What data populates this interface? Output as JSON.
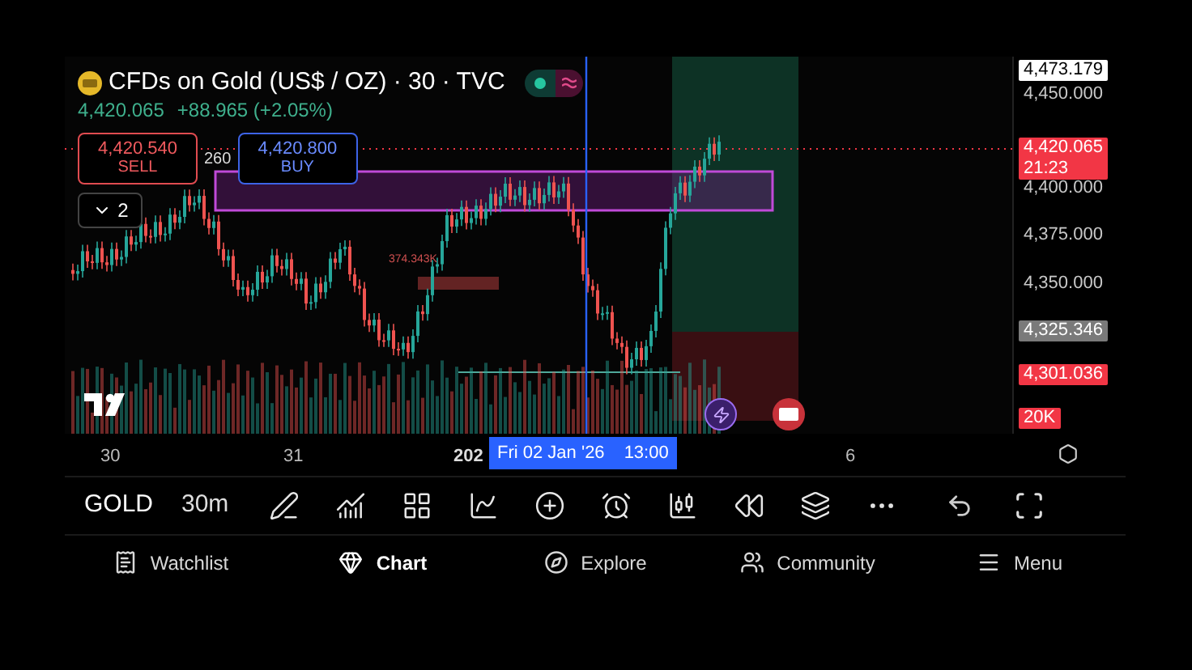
{
  "header": {
    "title": "CFDs on Gold (US$ / OZ) · 30 · TVC",
    "market_open": true,
    "price": "4,420.065",
    "change": "+88.965 (+2.05%)"
  },
  "trade": {
    "sell_price": "4,420.540",
    "sell_label": "SELL",
    "spread": "260",
    "buy_price": "4,420.800",
    "buy_label": "BUY"
  },
  "indicators_toggle": {
    "count": "2",
    "expanded": false
  },
  "chart_annotations": [
    "374.343K"
  ],
  "price_scale": [
    {
      "text": "4,473.179",
      "kind": "highlight"
    },
    {
      "text": "4,450.000",
      "kind": "tick"
    },
    {
      "text": "4,420.065",
      "sub": "21:23",
      "kind": "last"
    },
    {
      "text": "4,400.000",
      "kind": "tick"
    },
    {
      "text": "4,375.000",
      "kind": "tick"
    },
    {
      "text": "4,350.000",
      "kind": "tick"
    },
    {
      "text": "4,325.346",
      "kind": "gray"
    },
    {
      "text": "4,301.036",
      "kind": "red"
    },
    {
      "text": "20K",
      "kind": "red"
    }
  ],
  "time_scale": [
    {
      "text": "30",
      "kind": "tick"
    },
    {
      "text": "31",
      "kind": "tick"
    },
    {
      "text": "202",
      "kind": "bold"
    },
    {
      "text": "6",
      "kind": "tick"
    }
  ],
  "crosshair_label": {
    "date": "Fri 02 Jan '26",
    "time": "13:00"
  },
  "toolbar": {
    "symbol": "GOLD",
    "interval": "30m"
  },
  "nav": [
    {
      "label": "Watchlist",
      "selected": false
    },
    {
      "label": "Chart",
      "selected": true
    },
    {
      "label": "Explore",
      "selected": false
    },
    {
      "label": "Community",
      "selected": false
    },
    {
      "label": "Menu",
      "selected": false
    }
  ]
}
